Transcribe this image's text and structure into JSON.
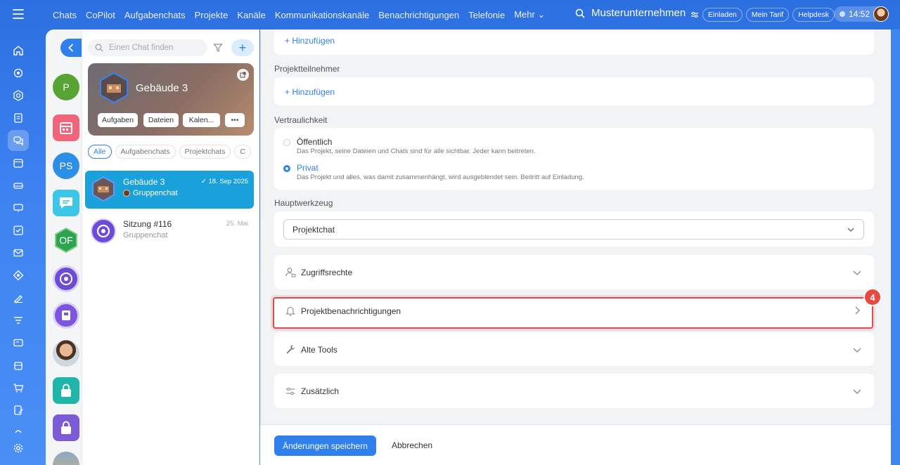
{
  "topnav": {
    "items": [
      "Chats",
      "CoPilot",
      "Aufgabenchats",
      "Projekte",
      "Kanäle",
      "Kommunikationskanäle",
      "Benachrichtigungen",
      "Telefonie",
      "Mehr ⌄"
    ],
    "company": "Musterunternehmen",
    "invite": "Einladen",
    "tariff": "Mein Tarif",
    "helpdesk": "Helpdesk",
    "time": "14:52"
  },
  "avatars": {
    "p": "P",
    "ps": "PS",
    "of": "OF"
  },
  "chatlist": {
    "search_placeholder": "Einen Chat finden",
    "cover_title": "Gebäude 3",
    "cover_buttons": [
      "Aufgaben",
      "Dateien",
      "Kalen..."
    ],
    "more": "•••",
    "tabs": [
      "Alle",
      "Aufgabenchats",
      "Projektchats",
      "C"
    ],
    "rows": [
      {
        "title": "Gebäude 3",
        "sub": "Gruppenchat",
        "date": "18. Sep 2025"
      },
      {
        "title": "Sitzung #116",
        "sub": "Gruppenchat",
        "date": "25. Mai"
      }
    ]
  },
  "settings": {
    "add_link": "+ Hinzufügen",
    "participants_label": "Projektteilnehmer",
    "participants_add": "+ Hinzufügen",
    "privacy_label": "Vertraulichkeit",
    "public_title": "Öffentlich",
    "public_desc": "Das Projekt, seine Dateien und Chats sind für alle sichtbar. Jeder kann beitreten.",
    "private_title": "Privat",
    "private_desc": "Das Projekt und alles, was damit zusammenhängt, wird ausgeblendet sein. Beitritt auf Einladung.",
    "main_tool_label": "Hauptwerkzeug",
    "main_tool_value": "Projektchat",
    "access": "Zugriffsrechte",
    "notifications": "Projektbenachrichtigungen",
    "old_tools": "Alte Tools",
    "extra": "Zusätzlich",
    "badge": "4",
    "save": "Änderungen speichern",
    "cancel": "Abbrechen"
  },
  "colors": {
    "accent": "#2f80ed",
    "selected_row": "#1aa1dc",
    "highlight": "#e04b4b"
  }
}
